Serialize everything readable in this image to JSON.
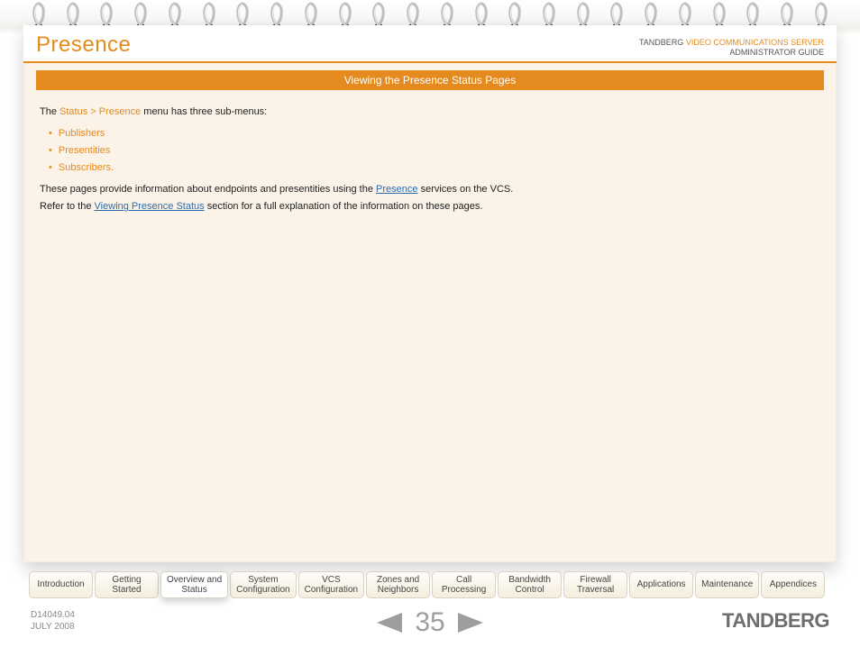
{
  "header": {
    "title": "Presence",
    "brand_prefix": "TANDBERG ",
    "brand_product": "VIDEO COMMUNICATIONS SERVER",
    "brand_line2": "ADMINISTRATOR GUIDE"
  },
  "banner": "Viewing the Presence Status Pages",
  "body": {
    "intro_prefix": "The ",
    "intro_path": "Status > Presence",
    "intro_suffix": " menu has three sub-menus:",
    "bullets": [
      "Publishers",
      "Presentities",
      "Subscribers."
    ],
    "para2_pre": "These pages provide information about endpoints and presentities using the ",
    "para2_link": "Presence",
    "para2_post": " services on the VCS.",
    "para3_pre": "Refer to the ",
    "para3_link": "Viewing Presence Status",
    "para3_post": " section for a full explanation of the information on these pages."
  },
  "tabs": [
    "Introduction",
    "Getting Started",
    "Overview and Status",
    "System Configuration",
    "VCS Configuration",
    "Zones and Neighbors",
    "Call Processing",
    "Bandwidth Control",
    "Firewall Traversal",
    "Applications",
    "Maintenance",
    "Appendices"
  ],
  "active_tab_index": 2,
  "footer": {
    "doc_id": "D14049.04",
    "date": "JULY 2008",
    "page_number": "35",
    "brand": "TANDBERG"
  }
}
